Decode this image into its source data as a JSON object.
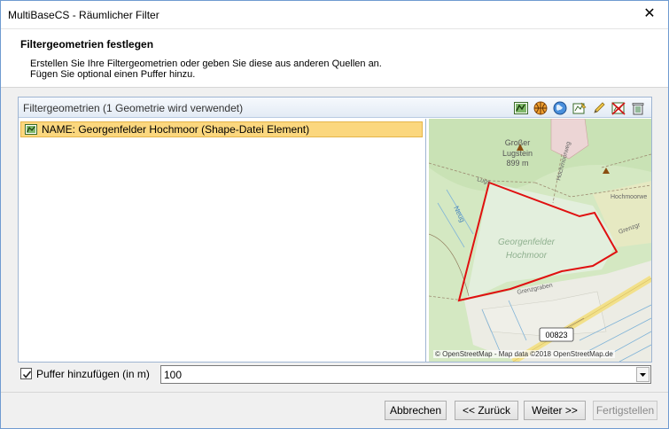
{
  "window": {
    "title": "MultiBaseCS - Räumlicher Filter",
    "close_glyph": "✕"
  },
  "header": {
    "title": "Filtergeometrien festlegen",
    "line1": "Erstellen Sie Ihre Filtergeometrien oder geben Sie diese aus anderen Quellen an.",
    "line2": "Fügen Sie optional einen Puffer hinzu."
  },
  "panel": {
    "title": "Filtergeometrien (1 Geometrie wird verwendet)",
    "toolbar": [
      {
        "icon": "shape-file-icon"
      },
      {
        "icon": "basketball-icon"
      },
      {
        "icon": "globe-icon"
      },
      {
        "icon": "edit-geometry-icon"
      },
      {
        "icon": "pencil-icon"
      },
      {
        "icon": "remove-geometry-icon"
      },
      {
        "icon": "trash-icon"
      }
    ],
    "items": [
      {
        "label": "NAME: Georgenfelder Hochmoor (Shape-Datei Element)",
        "selected": true
      }
    ]
  },
  "map": {
    "labels": {
      "peak_name_1": "Großer",
      "peak_name_2": "Lugstein",
      "peak_height": "899 m",
      "area_1": "Georgenfelder",
      "area_2": "Hochmoor",
      "road_ref": "00823",
      "street_lugs": "Lugs",
      "street_hochmoorweg": "Hochmoorweg",
      "street_hochmoorwe": "Hochmoorwe",
      "street_grenzgraben": "Grenzgraben",
      "street_neug": "Neug",
      "street_grenzgr": "Grenzgr"
    },
    "copyright": "© OpenStreetMap - Map data ©2018 OpenStreetMap.de",
    "colors": {
      "background": "#d6e9c7",
      "selection_outline": "#e01010"
    }
  },
  "buffer": {
    "checkbox_checked": true,
    "label": "Puffer hinzufügen (in m)",
    "value": "100"
  },
  "footer": {
    "cancel": "Abbrechen",
    "back": "<< Zurück",
    "next": "Weiter >>",
    "finish": "Fertigstellen"
  }
}
